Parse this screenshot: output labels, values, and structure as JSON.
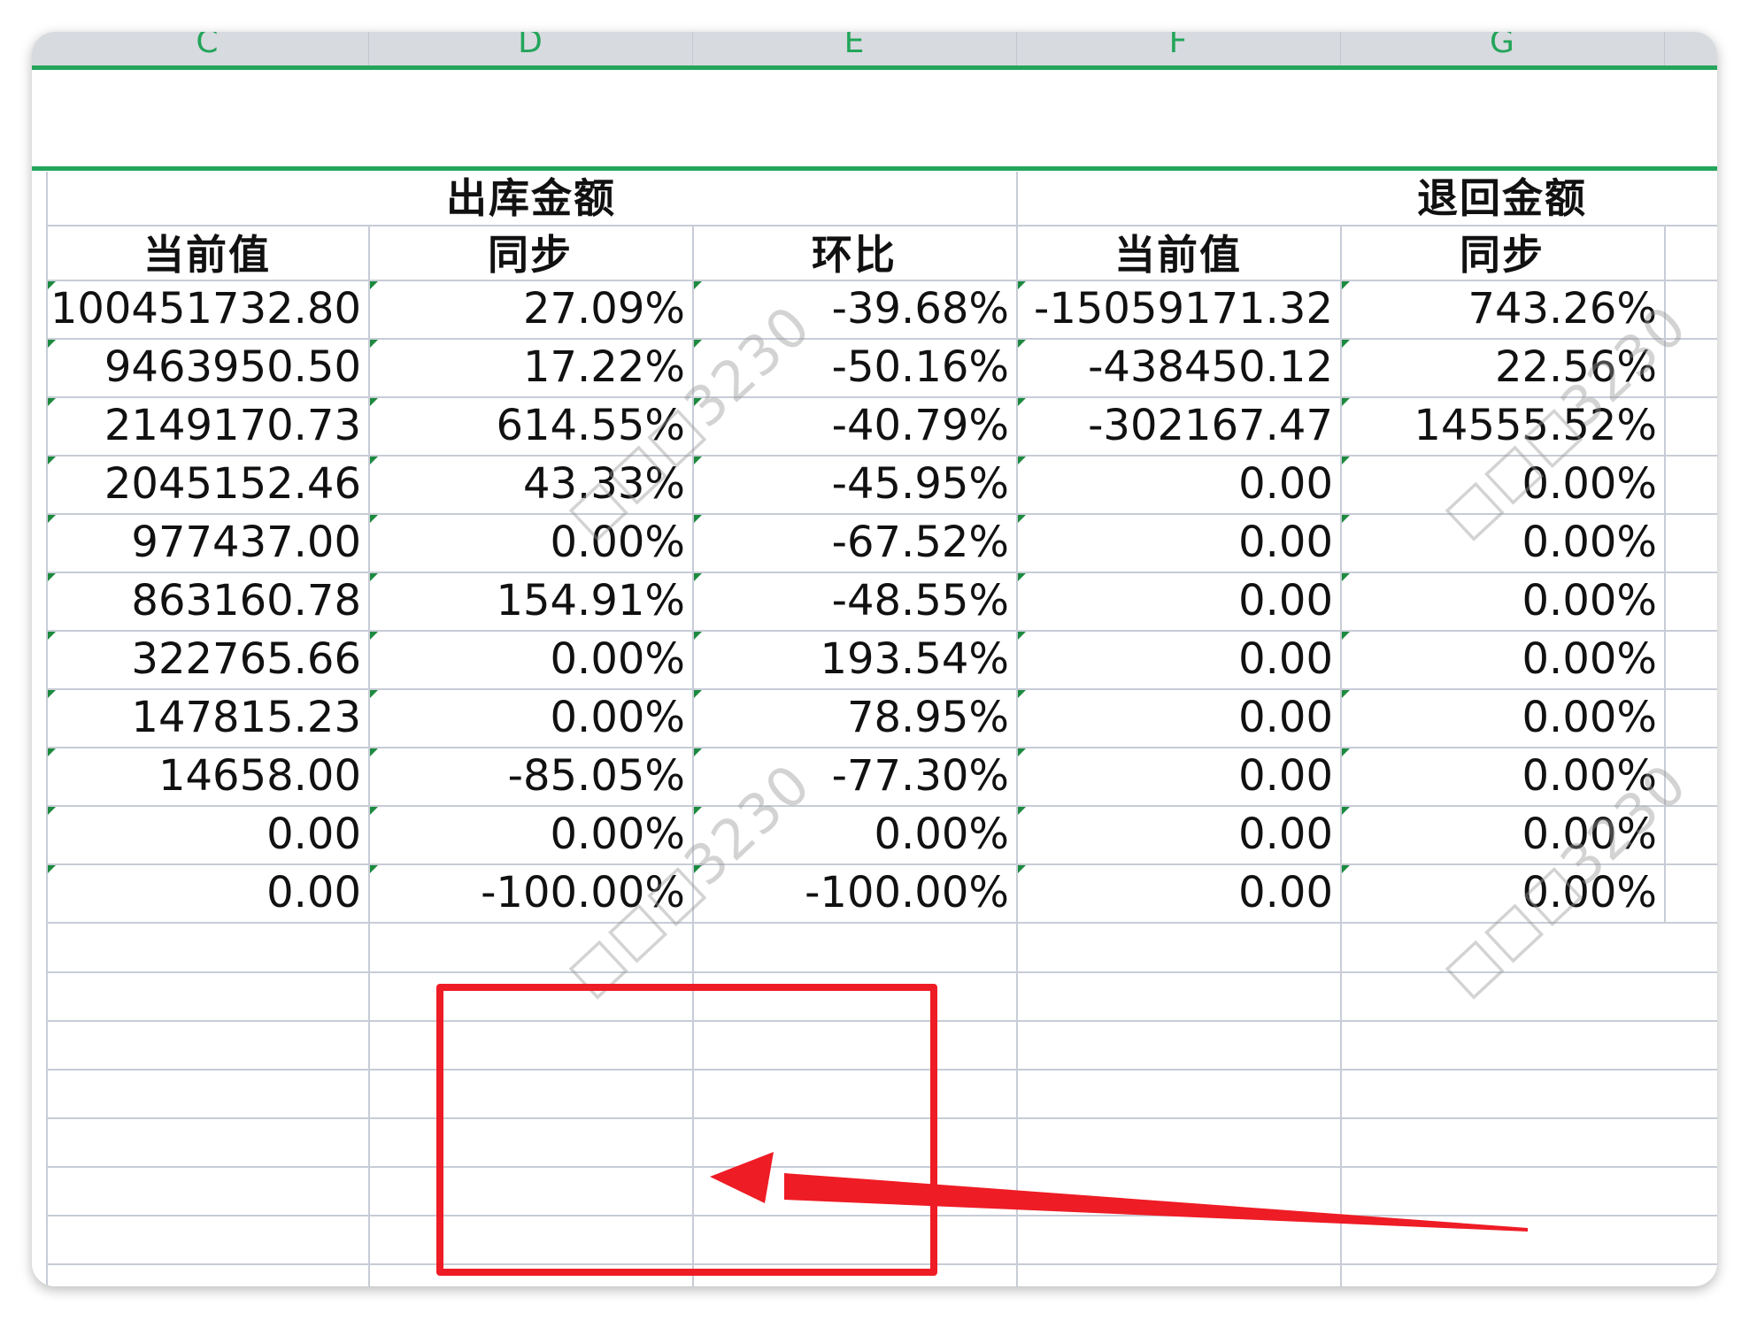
{
  "columns": [
    "C",
    "D",
    "E",
    "F",
    "G"
  ],
  "groups": {
    "outbound_title": "出库金额",
    "returned_title": "退回金额"
  },
  "sub_headers": [
    "当前值",
    "同步",
    "环比",
    "当前值",
    "同步"
  ],
  "rows": [
    [
      "100451732.80",
      "27.09%",
      "-39.68%",
      "-15059171.32",
      "743.26%"
    ],
    [
      "9463950.50",
      "17.22%",
      "-50.16%",
      "-438450.12",
      "22.56%"
    ],
    [
      "2149170.73",
      "614.55%",
      "-40.79%",
      "-302167.47",
      "14555.52%"
    ],
    [
      "2045152.46",
      "43.33%",
      "-45.95%",
      "0.00",
      "0.00%"
    ],
    [
      "977437.00",
      "0.00%",
      "-67.52%",
      "0.00",
      "0.00%"
    ],
    [
      "863160.78",
      "154.91%",
      "-48.55%",
      "0.00",
      "0.00%"
    ],
    [
      "322765.66",
      "0.00%",
      "193.54%",
      "0.00",
      "0.00%"
    ],
    [
      "147815.23",
      "0.00%",
      "78.95%",
      "0.00",
      "0.00%"
    ],
    [
      "14658.00",
      "-85.05%",
      "-77.30%",
      "0.00",
      "0.00%"
    ],
    [
      "0.00",
      "0.00%",
      "0.00%",
      "0.00",
      "0.00%"
    ],
    [
      "0.00",
      "-100.00%",
      "-100.00%",
      "0.00",
      "0.00%"
    ]
  ],
  "watermark": "□□□3230",
  "colors": {
    "accent_green": "#23a55a",
    "annotation_red": "#ee1c25",
    "gridline": "#c7ccd6",
    "header_bar": "#d7dadf"
  }
}
